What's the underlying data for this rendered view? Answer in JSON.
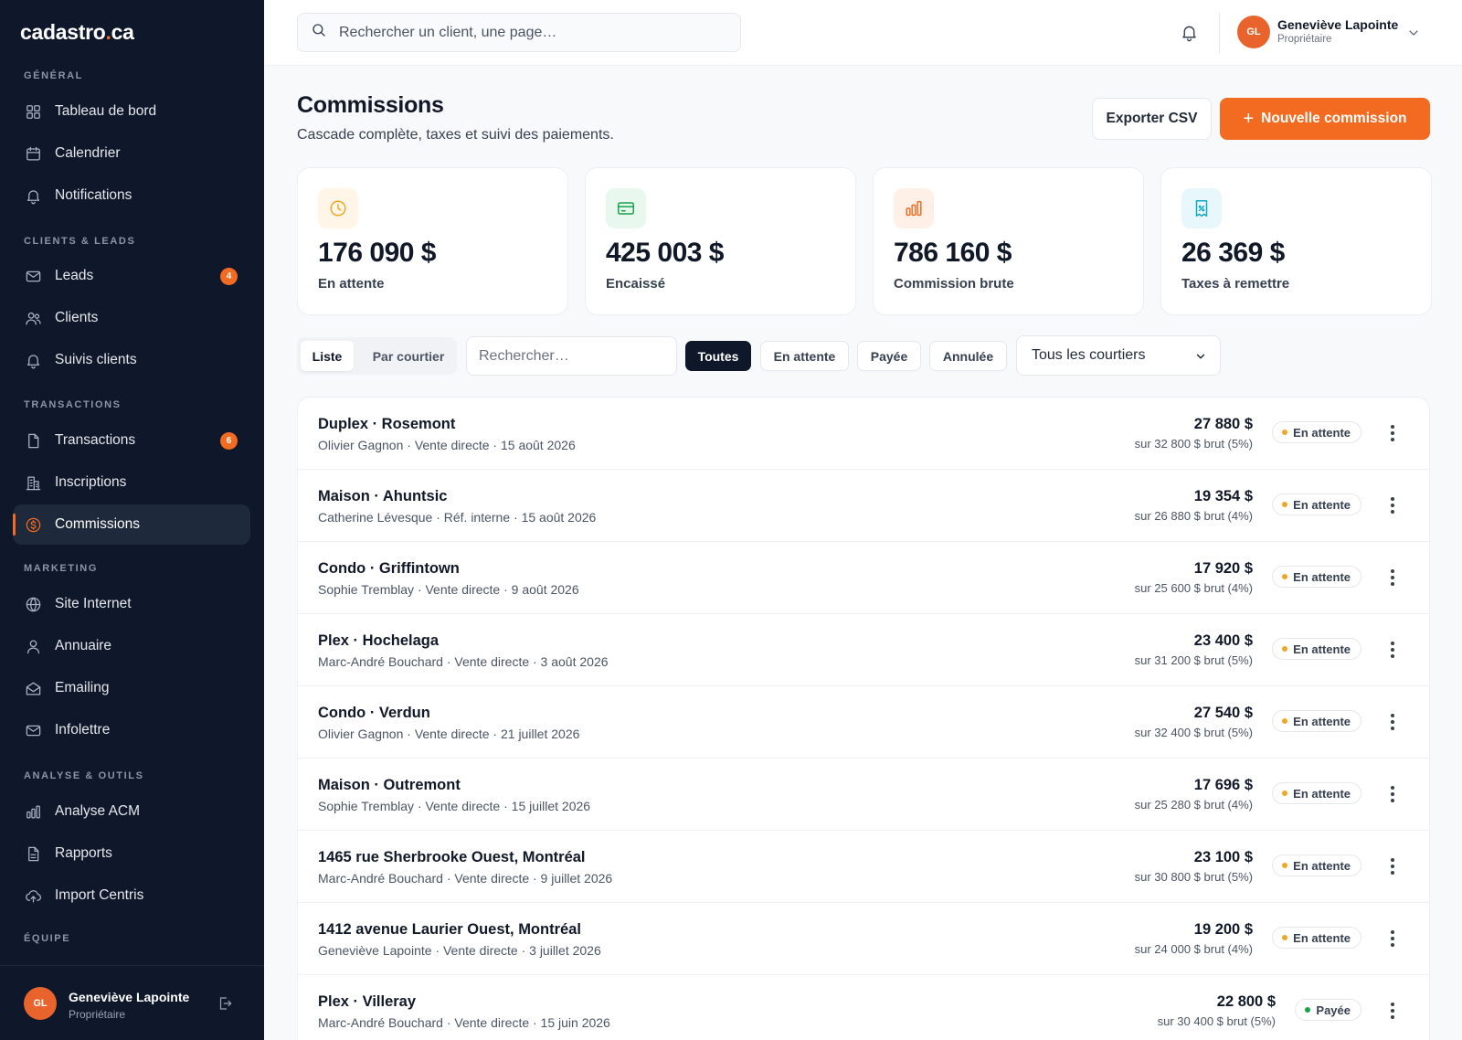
{
  "brand": {
    "name_main": "cadastro",
    "name_dot": ".",
    "name_tld": "ca"
  },
  "sidebar": {
    "sections": [
      {
        "label": "GÉNÉRAL"
      },
      {
        "label": "CLIENTS & LEADS"
      },
      {
        "label": "TRANSACTIONS"
      },
      {
        "label": "MARKETING"
      },
      {
        "label": "ANALYSE & OUTILS"
      },
      {
        "label": "ÉQUIPE"
      }
    ],
    "items": [
      {
        "label": "Tableau de bord",
        "icon": "grid-icon"
      },
      {
        "label": "Calendrier",
        "icon": "calendar-icon"
      },
      {
        "label": "Notifications",
        "icon": "bell-icon"
      },
      {
        "label": "Leads",
        "icon": "mail-icon",
        "badge": "4"
      },
      {
        "label": "Clients",
        "icon": "users-icon"
      },
      {
        "label": "Suivis clients",
        "icon": "bell-icon"
      },
      {
        "label": "Transactions",
        "icon": "document-icon",
        "badge": "6"
      },
      {
        "label": "Inscriptions",
        "icon": "building-icon"
      },
      {
        "label": "Commissions",
        "icon": "dollar-circle-icon",
        "active": true
      },
      {
        "label": "Site Internet",
        "icon": "globe-icon"
      },
      {
        "label": "Annuaire",
        "icon": "user-icon"
      },
      {
        "label": "Emailing",
        "icon": "mail-open-icon"
      },
      {
        "label": "Infolettre",
        "icon": "mail-icon"
      },
      {
        "label": "Analyse ACM",
        "icon": "bar-chart-icon"
      },
      {
        "label": "Rapports",
        "icon": "report-icon"
      },
      {
        "label": "Import Centris",
        "icon": "cloud-upload-icon"
      }
    ],
    "user": {
      "initials": "GL",
      "name": "Geneviève Lapointe",
      "role": "Propriétaire"
    }
  },
  "topbar": {
    "search_placeholder": "Rechercher un client, une page…",
    "user": {
      "initials": "GL",
      "name": "Geneviève Lapointe",
      "role": "Propriétaire"
    }
  },
  "header": {
    "title": "Commissions",
    "subtitle": "Cascade complète, taxes et suivi des paiements.",
    "export_label": "Exporter CSV",
    "new_label": "Nouvelle commission"
  },
  "stats": [
    {
      "value": "176 090 $",
      "label": "En attente",
      "icon": "clock-icon",
      "color": "#f5a524",
      "bg": "#fff6e8"
    },
    {
      "value": "425 003 $",
      "label": "Encaissé",
      "icon": "card-icon",
      "color": "#16a34a",
      "bg": "#e9f8ef"
    },
    {
      "value": "786 160 $",
      "label": "Commission brute",
      "icon": "bar-chart-icon",
      "color": "#f26b21",
      "bg": "#fff0e7"
    },
    {
      "value": "26 369 $",
      "label": "Taxes à remettre",
      "icon": "receipt-icon",
      "color": "#0ea5c6",
      "bg": "#e7f7fb"
    }
  ],
  "filters": {
    "views": [
      "Liste",
      "Par courtier"
    ],
    "search_placeholder": "Rechercher…",
    "chips": [
      "Toutes",
      "En attente",
      "Payée",
      "Annulée"
    ],
    "broker_select": "Tous les courtiers"
  },
  "commissions": [
    {
      "title": "Duplex · Rosemont",
      "meta": "Olivier Gagnon · Vente directe · 15 août 2026",
      "amount": "27 880 $",
      "sub": "sur 32 800 $ brut (5%)",
      "status": "En attente"
    },
    {
      "title": "Maison · Ahuntsic",
      "meta": "Catherine Lévesque · Réf. interne · 15 août 2026",
      "amount": "19 354 $",
      "sub": "sur 26 880 $ brut (4%)",
      "status": "En attente"
    },
    {
      "title": "Condo · Griffintown",
      "meta": "Sophie Tremblay · Vente directe · 9 août 2026",
      "amount": "17 920 $",
      "sub": "sur 25 600 $ brut (4%)",
      "status": "En attente"
    },
    {
      "title": "Plex · Hochelaga",
      "meta": "Marc-André Bouchard · Vente directe · 3 août 2026",
      "amount": "23 400 $",
      "sub": "sur 31 200 $ brut (5%)",
      "status": "En attente"
    },
    {
      "title": "Condo · Verdun",
      "meta": "Olivier Gagnon · Vente directe · 21 juillet 2026",
      "amount": "27 540 $",
      "sub": "sur 32 400 $ brut (5%)",
      "status": "En attente"
    },
    {
      "title": "Maison · Outremont",
      "meta": "Sophie Tremblay · Vente directe · 15 juillet 2026",
      "amount": "17 696 $",
      "sub": "sur 25 280 $ brut (4%)",
      "status": "En attente"
    },
    {
      "title": "1465 rue Sherbrooke Ouest, Montréal",
      "meta": "Marc-André Bouchard · Vente directe · 9 juillet 2026",
      "amount": "23 100 $",
      "sub": "sur 30 800 $ brut (5%)",
      "status": "En attente"
    },
    {
      "title": "1412 avenue Laurier Ouest, Montréal",
      "meta": "Geneviève Lapointe · Vente directe · 3 juillet 2026",
      "amount": "19 200 $",
      "sub": "sur 24 000 $ brut (4%)",
      "status": "En attente"
    },
    {
      "title": "Plex · Villeray",
      "meta": "Marc-André Bouchard · Vente directe · 15 juin 2026",
      "amount": "22 800 $",
      "sub": "sur 30 400 $ brut (5%)",
      "status": "Payée"
    }
  ]
}
